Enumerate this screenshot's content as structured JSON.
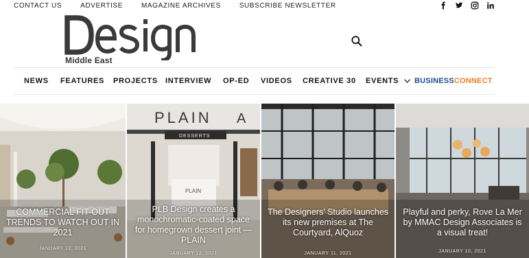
{
  "topbar": {
    "links": [
      "CONTACT US",
      "ADVERTISE",
      "MAGAZINE ARCHIVES",
      "SUBSCRIBE NEWSLETTER"
    ],
    "social_icons": [
      "facebook-icon",
      "twitter-icon",
      "instagram-icon",
      "linkedin-icon"
    ]
  },
  "logo": {
    "wordmark": "Design",
    "subtitle": "Middle East"
  },
  "header": {
    "search_icon": "search-icon"
  },
  "nav": {
    "items": [
      "NEWS",
      "FEATURES",
      "PROJECTS",
      "INTERVIEW",
      "OP-ED",
      "VIDEOS",
      "CREATIVE 30",
      "EVENTS"
    ],
    "events_icon": "chevron-down-icon",
    "business_connect": {
      "part1": "BUSINESS",
      "part2": "CONNECT"
    }
  },
  "cards": [
    {
      "title": "COMMERCIAL FIT-OUT TRENDS TO WATCH OUT IN 2021",
      "date": "JANUARY 12, 2021"
    },
    {
      "title": "PLB Design creates a monochromatic-coated space for homegrown dessert joint — PLAIN",
      "date": "JANUARY 12, 2021"
    },
    {
      "title": "The Designers' Studio launches its new premises at The Courtyard, AlQuoz",
      "date": "JANUARY 11, 2021"
    },
    {
      "title": "Playful and perky, Rove La Mer by MMAC Design Associates is a visual treat!",
      "date": "JANUARY 10, 2021"
    }
  ],
  "colors": {
    "business": "#1a4d8c",
    "connect": "#e8801e",
    "logo_gray": "#3a3a3a"
  }
}
